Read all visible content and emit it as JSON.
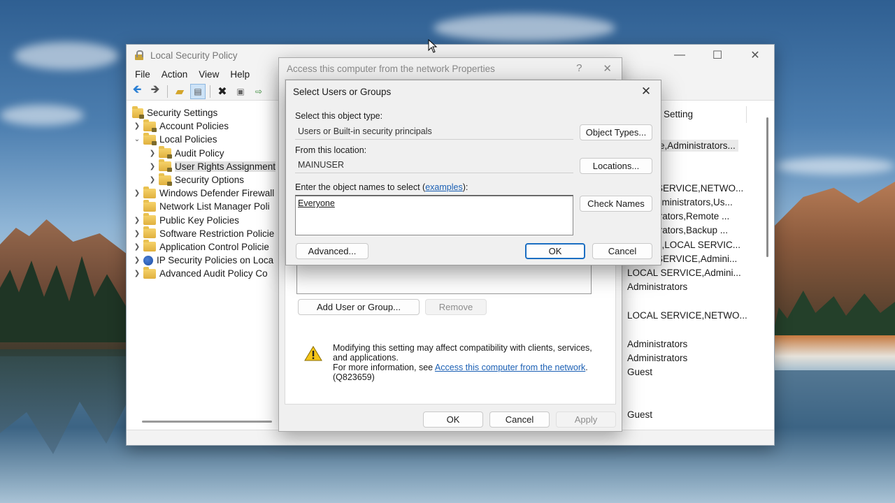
{
  "mmc": {
    "title": "Local Security Policy",
    "controls": {
      "minimize": "—",
      "maximize": "☐",
      "close": "✕"
    },
    "menu": [
      "File",
      "Action",
      "View",
      "Help"
    ],
    "tree": [
      {
        "label": "Security Settings",
        "icon": "security-settings-icon",
        "chevron": "",
        "indent": 0
      },
      {
        "label": "Account Policies",
        "icon": "folder-lock-icon",
        "chevron": ">",
        "indent": 1
      },
      {
        "label": "Local Policies",
        "icon": "folder-lock-icon",
        "chevron": "v",
        "indent": 1
      },
      {
        "label": "Audit Policy",
        "icon": "folder-lock-icon",
        "chevron": ">",
        "indent": 2
      },
      {
        "label": "User Rights Assignment",
        "icon": "folder-lock-icon",
        "chevron": ">",
        "indent": 2,
        "selected": true
      },
      {
        "label": "Security Options",
        "icon": "folder-lock-icon",
        "chevron": ">",
        "indent": 2
      },
      {
        "label": "Windows Defender Firewall",
        "icon": "folder-icon",
        "chevron": ">",
        "indent": 1
      },
      {
        "label": "Network List Manager Poli",
        "icon": "folder-icon",
        "chevron": "",
        "indent": 1
      },
      {
        "label": "Public Key Policies",
        "icon": "folder-icon",
        "chevron": ">",
        "indent": 1
      },
      {
        "label": "Software Restriction Policie",
        "icon": "folder-icon",
        "chevron": ">",
        "indent": 1
      },
      {
        "label": "Application Control Policie",
        "icon": "folder-icon",
        "chevron": ">",
        "indent": 1
      },
      {
        "label": "IP Security Policies on Loca",
        "icon": "shield-icon",
        "chevron": ">",
        "indent": 1
      },
      {
        "label": "Advanced Audit Policy Co",
        "icon": "folder-icon",
        "chevron": ">",
        "indent": 1
      }
    ],
    "column_header": "Setting",
    "settings": [
      {
        "text": "e,Administrators...",
        "first": true
      },
      {
        "text": "SERVICE,NETWO..."
      },
      {
        "text": "dministrators,Us..."
      },
      {
        "text": "trators,Remote ..."
      },
      {
        "text": "trators,Backup ..."
      },
      {
        "text": "e,LOCAL SERVIC..."
      },
      {
        "text": "SERVICE,Admini..."
      },
      {
        "text": "LOCAL SERVICE,Admini..."
      },
      {
        "text": "Administrators"
      },
      {
        "text": "LOCAL SERVICE,NETWO..."
      },
      {
        "text": "Administrators"
      },
      {
        "text": "Administrators"
      },
      {
        "text": "Guest"
      },
      {
        "text": "Guest"
      }
    ]
  },
  "props": {
    "title": "Access this computer from the network Properties",
    "help": "?",
    "close": "✕",
    "add_button": "Add User or Group...",
    "remove_button": "Remove",
    "warning_line1": "Modifying this setting may affect compatibility with clients, services, and applications.",
    "warning_prefix": "For more information, see ",
    "warning_link": "Access this computer from the network",
    "warning_suffix": ".",
    "warning_code": "(Q823659)",
    "ok": "OK",
    "cancel": "Cancel",
    "apply": "Apply"
  },
  "select": {
    "title": "Select Users or Groups",
    "close": "✕",
    "object_type_label": "Select this object type:",
    "object_type_value": "Users or Built-in security principals",
    "object_types_button": "Object Types...",
    "location_label": "From this location:",
    "location_value": "MAINUSER",
    "locations_button": "Locations...",
    "names_label_prefix": "Enter the object names to select (",
    "names_label_link": "examples",
    "names_label_suffix": "):",
    "names_value": "Everyone",
    "check_names_button": "Check Names",
    "advanced_button": "Advanced...",
    "ok": "OK",
    "cancel": "Cancel"
  }
}
